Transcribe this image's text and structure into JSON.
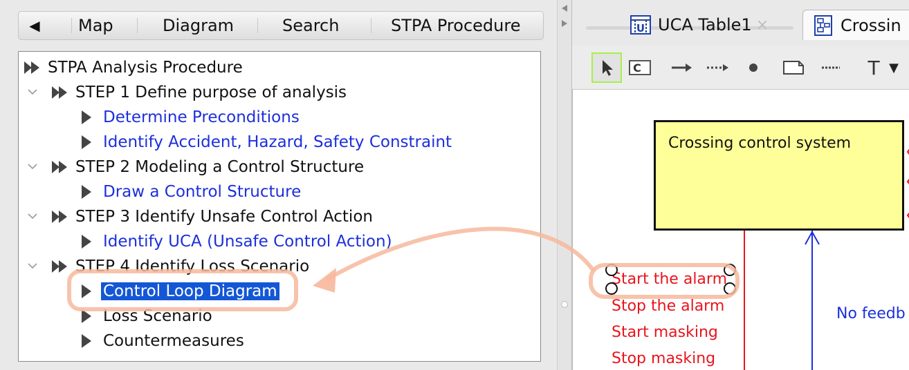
{
  "left_tabs": {
    "back_glyph": "◀",
    "items": [
      "Map",
      "Diagram",
      "Search",
      "STPA Procedure"
    ]
  },
  "tree": {
    "root": "STPA Analysis Procedure",
    "step1": {
      "label": "STEP 1 Define purpose of analysis",
      "children": [
        "Determine Preconditions",
        "Identify Accident, Hazard, Safety Constraint"
      ]
    },
    "step2": {
      "label": "STEP 2 Modeling a Control Structure",
      "children": [
        "Draw a Control Structure"
      ]
    },
    "step3": {
      "label": "STEP 3 Identify Unsafe Control Action",
      "children": [
        "Identify UCA (Unsafe Control Action)"
      ]
    },
    "step4": {
      "label": "STEP 4 Identify Loss Scenario",
      "children": [
        "Control Loop Diagram",
        "Loss Scenario",
        "Countermeasures"
      ]
    },
    "selected": "Control Loop Diagram",
    "link_color": "#1c2fdc",
    "selection_color": "#1457d6"
  },
  "editor_tabs": [
    {
      "label": "UCA Table1",
      "icon": "uca-table-icon",
      "close": "×"
    },
    {
      "label": "Crossin",
      "icon": "diagram-icon"
    }
  ],
  "toolbar": {
    "tools": [
      "select-pointer-icon",
      "component-icon",
      "arrow-icon",
      "dotted-arrow-icon",
      "point-icon",
      "note-icon",
      "dashed-line-icon",
      "text-icon",
      "dropdown-icon"
    ],
    "active_tool": "select-pointer-icon",
    "text_tool_glyph": "T",
    "dropdown_glyph": "▼",
    "active_border_color": "#a5f04a"
  },
  "diagram": {
    "box_label": "Crossing control system",
    "box_fill": "#ffff99",
    "control_actions": [
      "Start the alarm",
      "Stop the alarm",
      "Start masking",
      "Stop masking"
    ],
    "feedback_label": "No feedb",
    "action_color": "#e8141c",
    "feedback_color": "#1c2fdc"
  },
  "highlight_color": "#f7b89c"
}
